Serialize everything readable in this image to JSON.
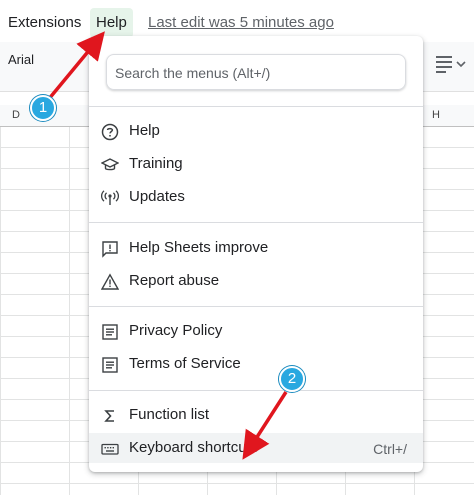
{
  "menubar": {
    "extensions_label": "Extensions",
    "help_label": "Help",
    "last_edit": "Last edit was 5 minutes ago"
  },
  "toolbar": {
    "font": "Arial",
    "align_icon": "align-left-icon"
  },
  "columns": {
    "d": "D",
    "h": "H"
  },
  "help_menu": {
    "search_placeholder": "Search the menus (Alt+/)",
    "groups": [
      [
        {
          "label": "Help",
          "icon": "question-circle-icon"
        },
        {
          "label": "Training",
          "icon": "graduation-cap-icon"
        },
        {
          "label": "Updates",
          "icon": "broadcast-icon"
        }
      ],
      [
        {
          "label": "Help Sheets improve",
          "icon": "feedback-icon"
        },
        {
          "label": "Report abuse",
          "icon": "warning-triangle-icon"
        }
      ],
      [
        {
          "label": "Privacy Policy",
          "icon": "document-icon"
        },
        {
          "label": "Terms of Service",
          "icon": "document-icon"
        }
      ],
      [
        {
          "label": "Function list",
          "icon": "sigma-icon"
        },
        {
          "label": "Keyboard shortcuts",
          "icon": "keyboard-icon",
          "shortcut": "Ctrl+/",
          "highlighted": true
        }
      ]
    ]
  },
  "annotations": {
    "badge_1": "1",
    "badge_2": "2",
    "color": "#29a8e0",
    "arrow_color": "#e0161e"
  }
}
